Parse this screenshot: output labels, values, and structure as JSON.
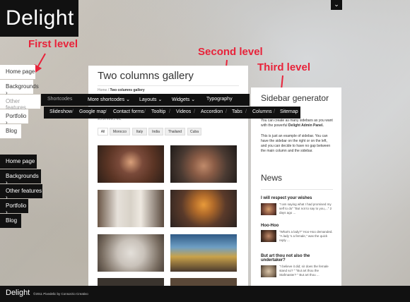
{
  "logo": "Delight",
  "footer": {
    "logo": "Delight",
    "copyright": "©2011 Pixedelic by Consorzio Creativo"
  },
  "annotations": {
    "first": "First level",
    "second": "Second level",
    "third": "Third level"
  },
  "left_nav_white": [
    "Home page",
    "Backgrounds",
    "Other features",
    "Portfolio",
    "Blog"
  ],
  "left_nav_dark": [
    "Home page",
    "Backgrounds",
    "Other features",
    "Portfolio",
    "Blog"
  ],
  "main": {
    "title": "Two columns gallery",
    "breadcrumb_home": "Home",
    "breadcrumb_sep": "/",
    "breadcrumb_current": "Two columns gallery",
    "partial_text": "scroll effect etc.",
    "filters": [
      "All",
      "Morocco",
      "Italy",
      "India",
      "Thailand",
      "Cuba"
    ]
  },
  "menu_second": {
    "items": [
      "Shortcodes",
      "More shortcodes",
      "Layouts",
      "Widgets",
      "Typography"
    ]
  },
  "menu_third": {
    "items": [
      "Slideshow",
      "Google map",
      "Contact forms",
      "Tooltip",
      "Videos",
      "Accordion",
      "Tabs",
      "Columns",
      "Sitemap"
    ],
    "sep": "/"
  },
  "sidebar": {
    "title": "Sidebar generator",
    "intro_1": "You can create as many sidebars as you want with the powerful",
    "intro_bold": "Delight Admin Panel.",
    "intro_2": "This is just an example of sidebar. You can have the sidebar on the right or on the left, and you can decide to have no gap between the main column and the sidebar.",
    "news_title": "News",
    "news": [
      {
        "title": "I will respect your wishes",
        "text": "\"I am saying what I had promised my self to do\" \"But not to say to you,...\" 2 days ago ..."
      },
      {
        "title": "Hoo-Hoo",
        "text": "\"What's a lady?\" Hoo-Hoo demanded. \"A lady 's a female,\" was the quick reply ..."
      },
      {
        "title": "But art thou not also the undertaker?",
        "text": "\"I believe it did; sir does the female stand so? \" \"But art thou the Stafmaster? \" But art thou ..."
      }
    ]
  },
  "colors": {
    "annotation": "#e8233a",
    "bar": "#111111"
  }
}
